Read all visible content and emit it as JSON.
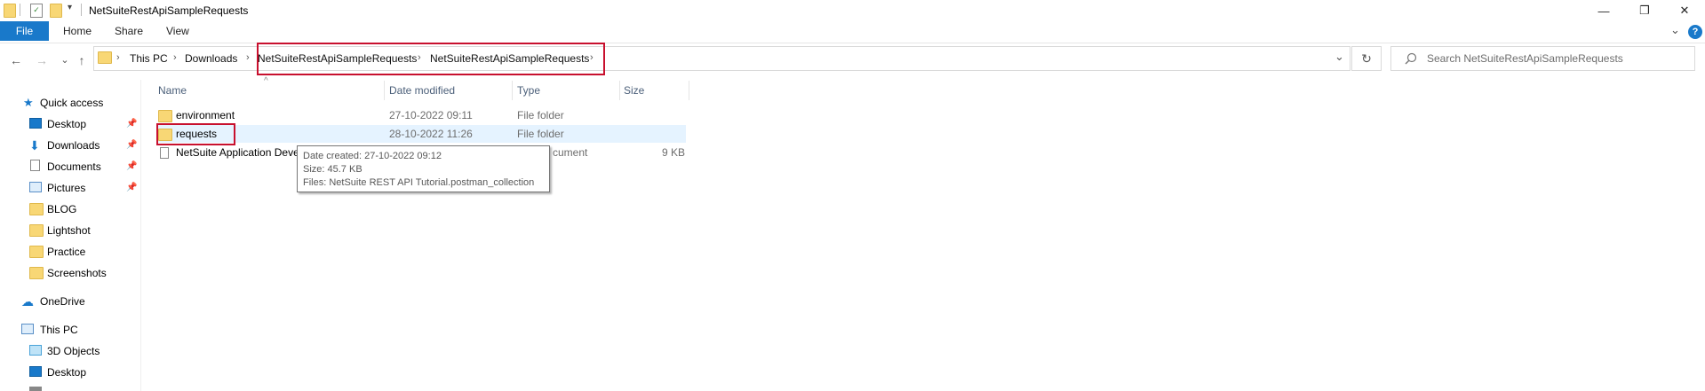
{
  "window": {
    "title": "NetSuiteRestApiSampleRequests",
    "minimize_icon": "minimize-icon",
    "maximize_icon": "restore-icon",
    "close_icon": "close-icon",
    "min_glyph": "—",
    "max_glyph": "❐",
    "close_glyph": "✕"
  },
  "ribbon": {
    "tabs": [
      "File",
      "Home",
      "Share",
      "View"
    ],
    "expand_glyph": "⌄",
    "help_glyph": "?"
  },
  "address": {
    "back_glyph": "←",
    "forward_glyph": "→",
    "recent_glyph": "⌄",
    "up_glyph": "↑",
    "crumbs": [
      "This PC",
      "Downloads",
      "NetSuiteRestApiSampleRequests",
      "NetSuiteRestApiSampleRequests"
    ],
    "sep_glyph": "›",
    "dropdown_glyph": "⌄",
    "refresh_glyph": "↻"
  },
  "search": {
    "placeholder": "Search NetSuiteRestApiSampleRequests",
    "icon": "search-icon"
  },
  "nav": {
    "quick_access": "Quick access",
    "items": [
      {
        "label": "Desktop",
        "icon": "desktop-icon",
        "pinned": true
      },
      {
        "label": "Downloads",
        "icon": "download-icon",
        "pinned": true
      },
      {
        "label": "Documents",
        "icon": "documents-icon",
        "pinned": true
      },
      {
        "label": "Pictures",
        "icon": "pictures-icon",
        "pinned": true
      },
      {
        "label": "BLOG",
        "icon": "folder-icon",
        "pinned": false
      },
      {
        "label": "Lightshot",
        "icon": "folder-icon",
        "pinned": false
      },
      {
        "label": "Practice",
        "icon": "folder-icon",
        "pinned": false
      },
      {
        "label": "Screenshots",
        "icon": "folder-icon",
        "pinned": false
      }
    ],
    "onedrive": "OneDrive",
    "this_pc": "This PC",
    "pc_items": [
      "3D Objects",
      "Desktop"
    ],
    "pin_glyph": "📌"
  },
  "columns": {
    "name": "Name",
    "date": "Date modified",
    "type": "Type",
    "size": "Size",
    "sort_glyph": "^"
  },
  "files": [
    {
      "name": "environment",
      "date": "27-10-2022 09:11",
      "type": "File folder",
      "size": ""
    },
    {
      "name": "requests",
      "date": "28-10-2022 11:26",
      "type": "File folder",
      "size": ""
    },
    {
      "name": "NetSuite Application Deve",
      "date": "",
      "type": "cument",
      "size": "9 KB"
    }
  ],
  "tooltip": {
    "created": "Date created: 27-10-2022 09:12",
    "size": "Size: 45.7 KB",
    "files": "Files: NetSuite REST API Tutorial.postman_collection"
  },
  "colors": {
    "accent": "#1979ca",
    "highlight": "#c8102e",
    "selection": "#e5f3ff",
    "folder": "#f8d775"
  }
}
